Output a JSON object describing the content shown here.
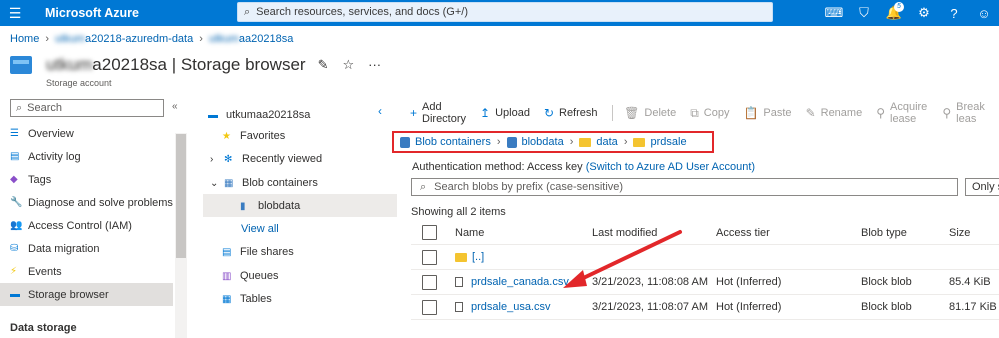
{
  "topbar": {
    "brand": "Microsoft Azure",
    "search_placeholder": "Search resources, services, and docs (G+/)",
    "notification_count": "5",
    "accent": "#0078d4"
  },
  "breadcrumb": {
    "home": "Home",
    "resource_group": "a20218-azuredm-data",
    "account": "aa20218sa"
  },
  "header": {
    "title": "a20218sa | Storage browser",
    "title_blurred_prefix": "utkum",
    "subtitle": "Storage account"
  },
  "leftnav": {
    "search_placeholder": "Search",
    "items": [
      {
        "label": "Overview",
        "icon": "overview-icon"
      },
      {
        "label": "Activity log",
        "icon": "activity-log-icon"
      },
      {
        "label": "Tags",
        "icon": "tag-icon"
      },
      {
        "label": "Diagnose and solve problems",
        "icon": "wrench-icon"
      },
      {
        "label": "Access Control (IAM)",
        "icon": "people-icon"
      },
      {
        "label": "Data migration",
        "icon": "migration-icon"
      },
      {
        "label": "Events",
        "icon": "lightning-icon"
      },
      {
        "label": "Storage browser",
        "icon": "storage-icon"
      }
    ],
    "section_heading": "Data storage"
  },
  "tree": {
    "account": "utkumaa20218sa",
    "favorites": "Favorites",
    "recently_viewed": "Recently viewed",
    "blob_containers": "Blob containers",
    "blobdata": "blobdata",
    "view_all": "View all",
    "file_shares": "File shares",
    "queues": "Queues",
    "tables": "Tables"
  },
  "toolbar": {
    "add_directory": "Add Directory",
    "upload": "Upload",
    "refresh": "Refresh",
    "delete": "Delete",
    "copy": "Copy",
    "paste": "Paste",
    "rename": "Rename",
    "acquire_lease": "Acquire lease",
    "break_lease": "Break leas"
  },
  "path": {
    "blob_containers": "Blob containers",
    "container": "blobdata",
    "folder1": "data",
    "folder2": "prdsale"
  },
  "auth": {
    "label": "Authentication method:",
    "value": "Access key",
    "switch": "(Switch to Azure AD User Account)"
  },
  "blob_search": {
    "placeholder": "Search blobs by prefix (case-sensitive)",
    "only_show": "Only s"
  },
  "listing": {
    "showing": "Showing all 2 items",
    "columns": {
      "name": "Name",
      "modified": "Last modified",
      "tier": "Access tier",
      "type": "Blob type",
      "size": "Size"
    },
    "parent": "[..]",
    "rows": [
      {
        "name": "prdsale_canada.csv",
        "modified": "3/21/2023, 11:08:08 AM",
        "tier": "Hot (Inferred)",
        "type": "Block blob",
        "size": "85.4 KiB"
      },
      {
        "name": "prdsale_usa.csv",
        "modified": "3/21/2023, 11:08:07 AM",
        "tier": "Hot (Inferred)",
        "type": "Block blob",
        "size": "81.17 KiB"
      }
    ]
  },
  "annotation_color": "#e2272a"
}
